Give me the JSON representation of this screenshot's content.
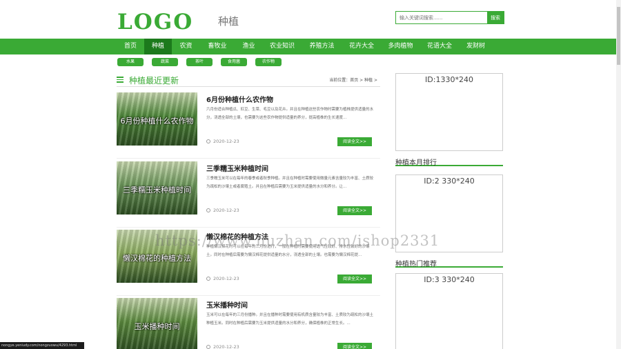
{
  "header": {
    "logo": "LOGO",
    "site_category": "种植",
    "search_placeholder": "输入关键词搜索......",
    "search_button": "搜索"
  },
  "nav": [
    {
      "label": "首页",
      "width": 40,
      "active": false
    },
    {
      "label": "种植",
      "width": 40,
      "active": true
    },
    {
      "label": "农资",
      "width": 41,
      "active": false
    },
    {
      "label": "畜牧业",
      "width": 50,
      "active": false
    },
    {
      "label": "渔业",
      "width": 41,
      "active": false
    },
    {
      "label": "农业知识",
      "width": 56,
      "active": false
    },
    {
      "label": "养殖方法",
      "width": 59,
      "active": false
    },
    {
      "label": "花卉大全",
      "width": 56,
      "active": false
    },
    {
      "label": "多肉植物",
      "width": 57,
      "active": false
    },
    {
      "label": "花语大全",
      "width": 56,
      "active": false
    },
    {
      "label": "发财树",
      "width": 49,
      "active": false
    }
  ],
  "tags": [
    "水果",
    "蔬菜",
    "茶叶",
    "食用菌",
    "农作物"
  ],
  "section": {
    "title": "种植最近更新",
    "breadcrumb": "当前位置：首页 > 种植 >"
  },
  "articles": [
    {
      "title": "6月份种植什么农作物",
      "thumb_text": "6月份种植什么农作物",
      "desc": "六月份适合种植瓜、豇豆、生菜、毛豆以及花卉。并且在种植这些农作物时需要为植株提供适量的水分，浇透全部的土壤，也需要为这些农作物提供适量的养分，提高植株的生长速度...",
      "date": "2020-12-23",
      "button": "阅读全文>>",
      "thumb_color": "#4f8a3a"
    },
    {
      "title": "三季糯玉米种植时间",
      "thumb_text": "三季糯玉米种植时间",
      "desc": "三季糯玉米可以在每年的春季或者秋季种植。并且在种植时需要使用微量元素含量较为丰富、土质较为疏松的沙壤土或者腐殖土。并且在种植后需要为玉米提供适量的水分和养分。让...",
      "date": "2020-12-23",
      "button": "阅读全文>>",
      "thumb_color": "#6e9a5c"
    },
    {
      "title": "懒汉棉花的种植方法",
      "thumb_text": "懒汉棉花的种植方法",
      "desc": "种植懒汉棉花时可以在每年的三月份进行，一般在种植时需要使用透气性较好、排水性较好的沙壤土。同时在种植后需要为懒汉棉花提供适量的水分，浇透全部的土壤。也需要为懒汉棉花提...",
      "date": "2020-12-23",
      "button": "阅读全文>>",
      "thumb_color": "#8cae5e"
    },
    {
      "title": "玉米播种时间",
      "thumb_text": "玉米播种时间",
      "desc": "玉米可以在每年的三月份播种。并且在播种时需要使用有机质含量较为丰富、土质较为疏松的沙壤土种植玉米。同时在种植后需要为玉米提供适量的水分和养分，确保植株的正常生长。...",
      "date": "2020-12-23",
      "button": "阅读全文>>",
      "thumb_color": "#5d8d3f"
    }
  ],
  "sidebar": {
    "ad1": "ID:1330*240",
    "monthly_title": "种植本月排行",
    "ad2": "ID:2 330*240",
    "hot_title": "种植热门推荐",
    "ad3": "ID:3 330*240"
  },
  "watermark": "https://www.huzhan.com/ishop2331",
  "status_url": "nongye.yeniudy.com/nongzuowu/4293.html",
  "colors": {
    "accent": "#3aaa35",
    "nav_active": "#1c7a1c"
  }
}
